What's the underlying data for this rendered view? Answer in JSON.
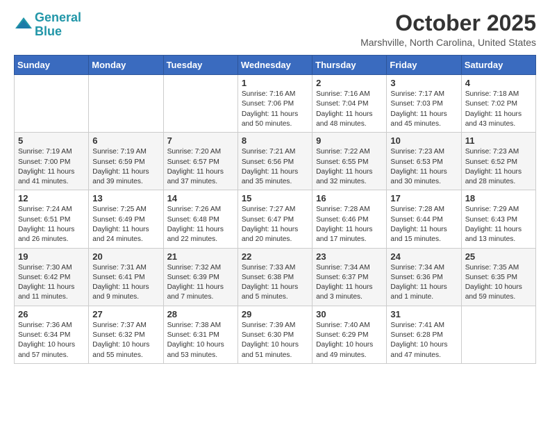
{
  "header": {
    "logo_line1": "General",
    "logo_line2": "Blue",
    "month": "October 2025",
    "location": "Marshville, North Carolina, United States"
  },
  "weekdays": [
    "Sunday",
    "Monday",
    "Tuesday",
    "Wednesday",
    "Thursday",
    "Friday",
    "Saturday"
  ],
  "weeks": [
    [
      {
        "day": "",
        "info": ""
      },
      {
        "day": "",
        "info": ""
      },
      {
        "day": "",
        "info": ""
      },
      {
        "day": "1",
        "info": "Sunrise: 7:16 AM\nSunset: 7:06 PM\nDaylight: 11 hours\nand 50 minutes."
      },
      {
        "day": "2",
        "info": "Sunrise: 7:16 AM\nSunset: 7:04 PM\nDaylight: 11 hours\nand 48 minutes."
      },
      {
        "day": "3",
        "info": "Sunrise: 7:17 AM\nSunset: 7:03 PM\nDaylight: 11 hours\nand 45 minutes."
      },
      {
        "day": "4",
        "info": "Sunrise: 7:18 AM\nSunset: 7:02 PM\nDaylight: 11 hours\nand 43 minutes."
      }
    ],
    [
      {
        "day": "5",
        "info": "Sunrise: 7:19 AM\nSunset: 7:00 PM\nDaylight: 11 hours\nand 41 minutes."
      },
      {
        "day": "6",
        "info": "Sunrise: 7:19 AM\nSunset: 6:59 PM\nDaylight: 11 hours\nand 39 minutes."
      },
      {
        "day": "7",
        "info": "Sunrise: 7:20 AM\nSunset: 6:57 PM\nDaylight: 11 hours\nand 37 minutes."
      },
      {
        "day": "8",
        "info": "Sunrise: 7:21 AM\nSunset: 6:56 PM\nDaylight: 11 hours\nand 35 minutes."
      },
      {
        "day": "9",
        "info": "Sunrise: 7:22 AM\nSunset: 6:55 PM\nDaylight: 11 hours\nand 32 minutes."
      },
      {
        "day": "10",
        "info": "Sunrise: 7:23 AM\nSunset: 6:53 PM\nDaylight: 11 hours\nand 30 minutes."
      },
      {
        "day": "11",
        "info": "Sunrise: 7:23 AM\nSunset: 6:52 PM\nDaylight: 11 hours\nand 28 minutes."
      }
    ],
    [
      {
        "day": "12",
        "info": "Sunrise: 7:24 AM\nSunset: 6:51 PM\nDaylight: 11 hours\nand 26 minutes."
      },
      {
        "day": "13",
        "info": "Sunrise: 7:25 AM\nSunset: 6:49 PM\nDaylight: 11 hours\nand 24 minutes."
      },
      {
        "day": "14",
        "info": "Sunrise: 7:26 AM\nSunset: 6:48 PM\nDaylight: 11 hours\nand 22 minutes."
      },
      {
        "day": "15",
        "info": "Sunrise: 7:27 AM\nSunset: 6:47 PM\nDaylight: 11 hours\nand 20 minutes."
      },
      {
        "day": "16",
        "info": "Sunrise: 7:28 AM\nSunset: 6:46 PM\nDaylight: 11 hours\nand 17 minutes."
      },
      {
        "day": "17",
        "info": "Sunrise: 7:28 AM\nSunset: 6:44 PM\nDaylight: 11 hours\nand 15 minutes."
      },
      {
        "day": "18",
        "info": "Sunrise: 7:29 AM\nSunset: 6:43 PM\nDaylight: 11 hours\nand 13 minutes."
      }
    ],
    [
      {
        "day": "19",
        "info": "Sunrise: 7:30 AM\nSunset: 6:42 PM\nDaylight: 11 hours\nand 11 minutes."
      },
      {
        "day": "20",
        "info": "Sunrise: 7:31 AM\nSunset: 6:41 PM\nDaylight: 11 hours\nand 9 minutes."
      },
      {
        "day": "21",
        "info": "Sunrise: 7:32 AM\nSunset: 6:39 PM\nDaylight: 11 hours\nand 7 minutes."
      },
      {
        "day": "22",
        "info": "Sunrise: 7:33 AM\nSunset: 6:38 PM\nDaylight: 11 hours\nand 5 minutes."
      },
      {
        "day": "23",
        "info": "Sunrise: 7:34 AM\nSunset: 6:37 PM\nDaylight: 11 hours\nand 3 minutes."
      },
      {
        "day": "24",
        "info": "Sunrise: 7:34 AM\nSunset: 6:36 PM\nDaylight: 11 hours\nand 1 minute."
      },
      {
        "day": "25",
        "info": "Sunrise: 7:35 AM\nSunset: 6:35 PM\nDaylight: 10 hours\nand 59 minutes."
      }
    ],
    [
      {
        "day": "26",
        "info": "Sunrise: 7:36 AM\nSunset: 6:34 PM\nDaylight: 10 hours\nand 57 minutes."
      },
      {
        "day": "27",
        "info": "Sunrise: 7:37 AM\nSunset: 6:32 PM\nDaylight: 10 hours\nand 55 minutes."
      },
      {
        "day": "28",
        "info": "Sunrise: 7:38 AM\nSunset: 6:31 PM\nDaylight: 10 hours\nand 53 minutes."
      },
      {
        "day": "29",
        "info": "Sunrise: 7:39 AM\nSunset: 6:30 PM\nDaylight: 10 hours\nand 51 minutes."
      },
      {
        "day": "30",
        "info": "Sunrise: 7:40 AM\nSunset: 6:29 PM\nDaylight: 10 hours\nand 49 minutes."
      },
      {
        "day": "31",
        "info": "Sunrise: 7:41 AM\nSunset: 6:28 PM\nDaylight: 10 hours\nand 47 minutes."
      },
      {
        "day": "",
        "info": ""
      }
    ]
  ]
}
